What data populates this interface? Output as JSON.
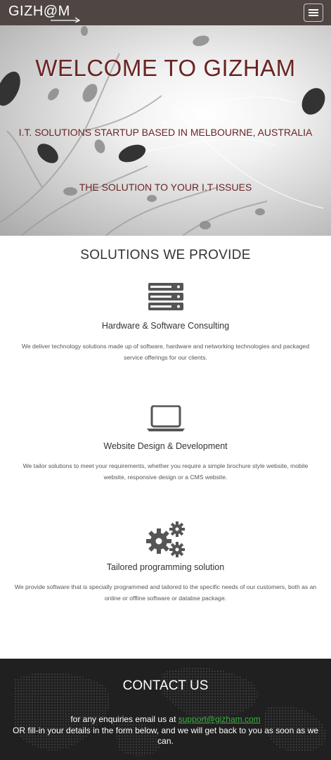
{
  "navbar": {
    "brand": "GIZH@M",
    "menu_icon": "hamburger-menu-icon",
    "background": "#4f4644"
  },
  "hero": {
    "title": "WELCOME TO GIZHAM",
    "subtitle": "I.T. SOLUTIONS STARTUP BASED IN MELBOURNE, AUSTRALIA",
    "tagline": "THE SOLUTION TO YOUR I.T ISSUES",
    "text_color": "#6b2424"
  },
  "solutions": {
    "heading": "SOLUTIONS WE PROVIDE",
    "items": [
      {
        "icon": "server-icon",
        "title": "Hardware & Software Consulting",
        "description": "We deliver technology solutions made up of software, hardware and networking technologies and packaged service offerings for our clients."
      },
      {
        "icon": "laptop-icon",
        "title": "Website Design & Development",
        "description": "We tailor solutions to meet your requirements, whether you require a simple brochure style website, mobile website, responsive design or a CMS website."
      },
      {
        "icon": "gears-icon",
        "title": "Tailored programming solution",
        "description": "We provide software that is specially programmed and tailored to the specific needs of our customers, both as an online or offline software or databse package."
      }
    ]
  },
  "contact": {
    "heading": "CONTACT US",
    "email_prefix": "for any enquiries email us at ",
    "email": "support@gizham.com",
    "form_text": "OR fill-in your details in the form below, and we will get back to you as soon as we can.",
    "link_color": "#3cb043"
  }
}
